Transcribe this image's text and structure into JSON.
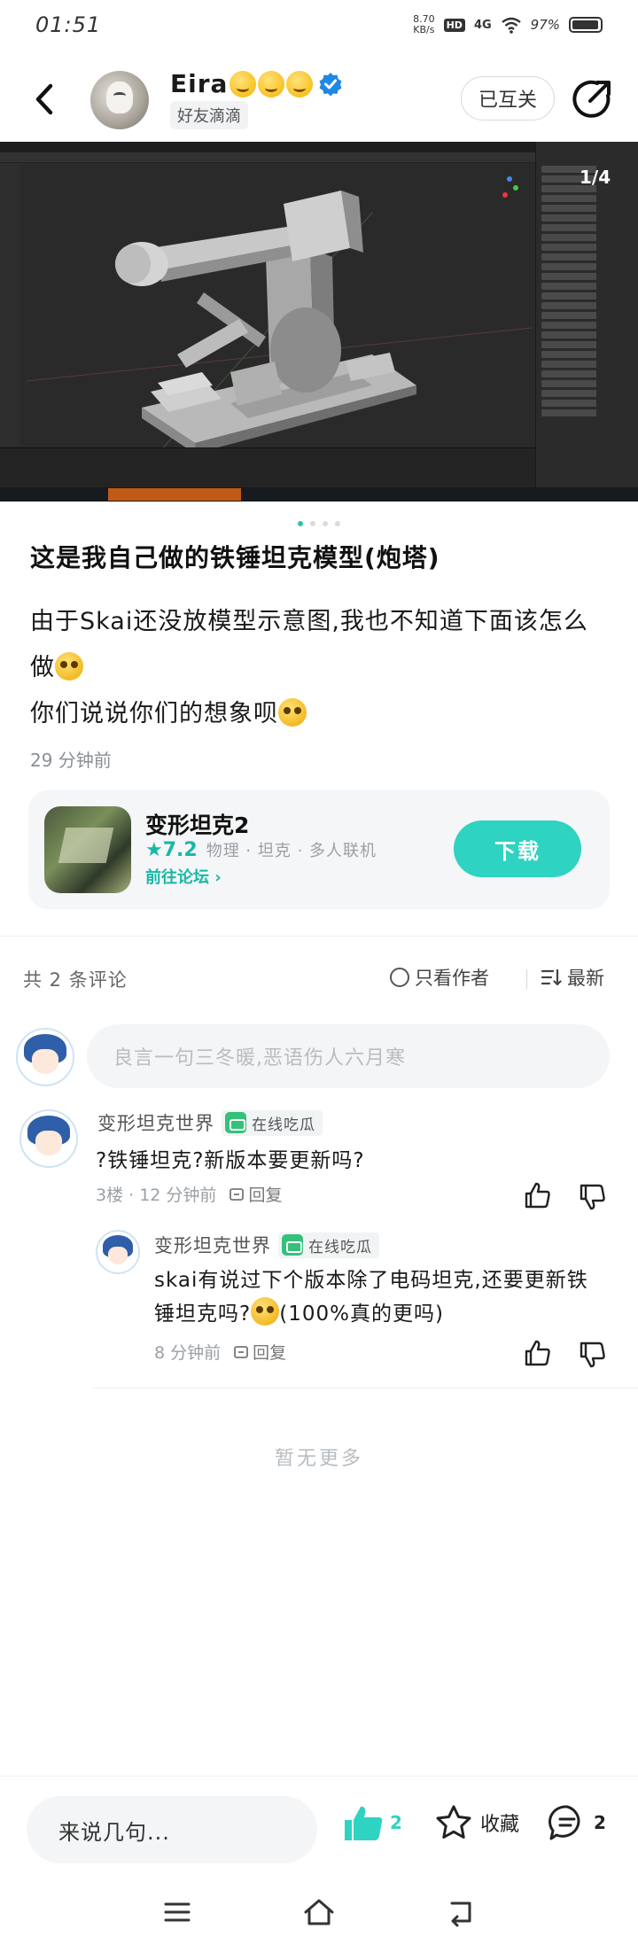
{
  "status_bar": {
    "time": "01:51",
    "net_speed_value": "8.70",
    "net_speed_unit": "KB/s",
    "hd": "HD",
    "signal": "4G",
    "battery": "97%"
  },
  "header": {
    "user_name": "Eira",
    "friend_tag": "好友滴滴",
    "follow_label": "已互关"
  },
  "carousel": {
    "page_indicator": "1/4",
    "total_pages": 4,
    "active_page": 1
  },
  "post": {
    "title": "这是我自己做的铁锤坦克模型(炮塔)",
    "body_line1": "由于Skai还没放模型示意图,我也不知道下面该怎么做",
    "body_line2": "你们说说你们的想象呗",
    "time": "29 分钟前"
  },
  "game_card": {
    "name": "变形坦克2",
    "rating": "★7.2",
    "tags": "物理 · 坦克 · 多人联机",
    "forum_link": "前往论坛 ›",
    "download_label": "下载"
  },
  "comments_header": {
    "count_label": "共 2 条评论",
    "author_only_label": "只看作者",
    "sort_label": "最新"
  },
  "comment_input": {
    "placeholder": "良言一句三冬暖,恶语伤人六月寒"
  },
  "comments": [
    {
      "author": "变形坦克世界",
      "device": "在线吃瓜",
      "text": "?铁锤坦克?新版本要更新吗?",
      "meta": "3楼 · 12 分钟前",
      "reply_label": "回复"
    }
  ],
  "replies": [
    {
      "author": "变形坦克世界",
      "device": "在线吃瓜",
      "text_part1": "skai有说过下个版本除了电码坦克,还要更新铁锤坦克吗?",
      "text_part2": "(100%真的更吗)",
      "meta": "8 分钟前",
      "reply_label": "回复"
    }
  ],
  "no_more": "暂无更多",
  "bottom_bar": {
    "input_label": "来说几句...",
    "like_count": "2",
    "favorite_label": "收藏",
    "comment_count": "2"
  },
  "colors": {
    "accent": "#2ed3c1",
    "accent_text": "#17b8a6",
    "verify_blue": "#1e88e5",
    "device_green": "#35c17a"
  }
}
